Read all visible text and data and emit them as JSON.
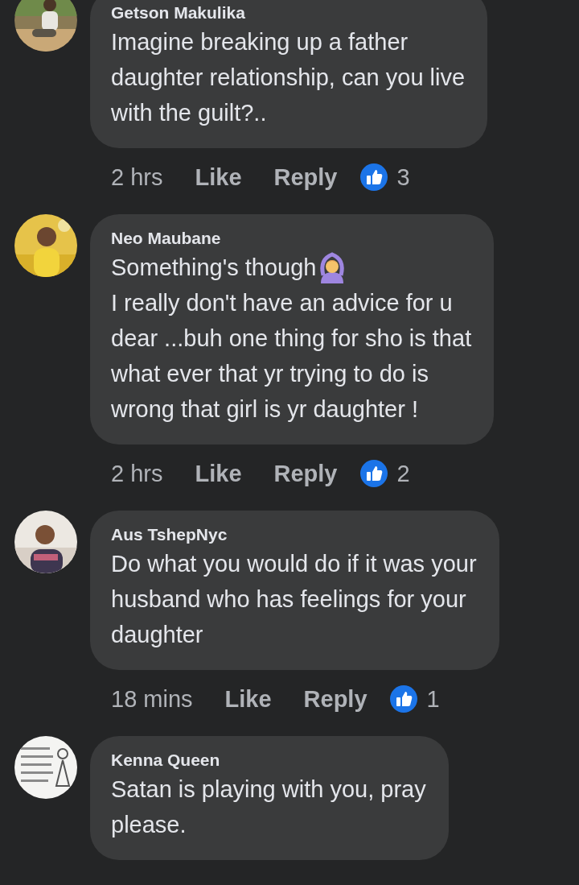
{
  "comments": [
    {
      "author": "Getson Makulika",
      "avatar": {
        "kind": "picture"
      },
      "paragraphs": [
        {
          "text": "Imagine breaking up a father\ndaughter relationship, can you live\nwith the guilt?.."
        }
      ],
      "time": "2 hrs",
      "like": "Like",
      "reply": "Reply",
      "reactions": "3"
    },
    {
      "author": "Neo Maubane",
      "avatar": {
        "kind": "picture"
      },
      "paragraphs": [
        {
          "text": "Something's though",
          "kind": "emoji"
        },
        {
          "text": "I really don't have an advice for u\ndear ...buh one thing for sho is that\nwhat ever that yr trying to do is\nwrong that girl is yr daughter !"
        }
      ],
      "time": "2 hrs",
      "like": "Like",
      "reply": "Reply",
      "reactions": "2"
    },
    {
      "author": "Aus TshepNyc",
      "avatar": {
        "kind": "picture"
      },
      "paragraphs": [
        {
          "text": "Do what you would do if it was your\nhusband who has feelings for your\ndaughter"
        }
      ],
      "time": "18 mins",
      "like": "Like",
      "reply": "Reply",
      "reactions": "1"
    },
    {
      "author": "Kenna Queen",
      "avatar": {
        "kind": "picture"
      },
      "paragraphs": [
        {
          "text": "Satan is playing with you, pray\nplease."
        }
      ]
    }
  ]
}
